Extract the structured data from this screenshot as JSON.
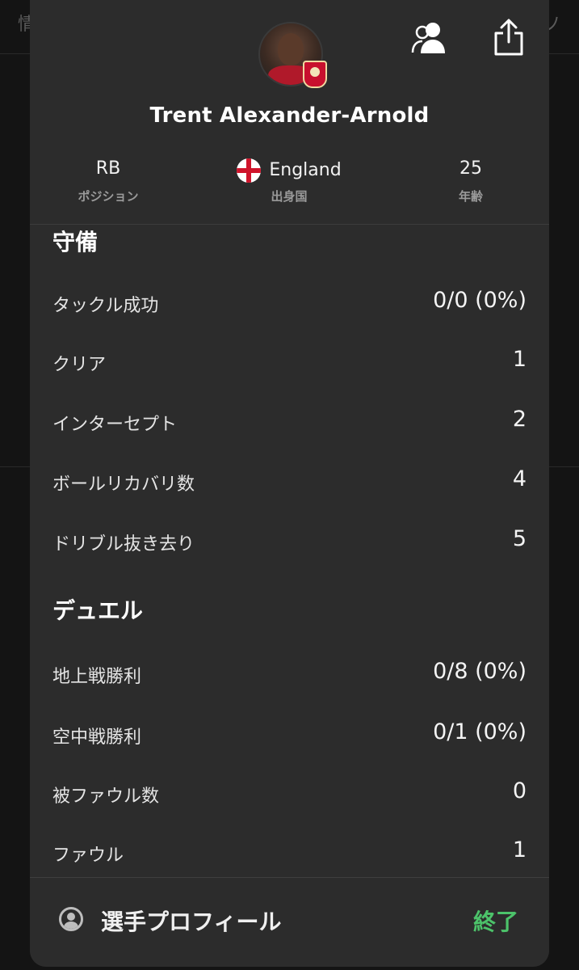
{
  "background": {
    "left_text": "情",
    "right_text": "ソ"
  },
  "header": {
    "icons": {
      "avatar": "player-photo",
      "badge": "club-badge",
      "compare": "people-icon",
      "share": "share-icon"
    },
    "player_name": "Trent Alexander-Arnold",
    "position": {
      "value": "RB",
      "label": "ポジション"
    },
    "country": {
      "value": "England",
      "label": "出身国",
      "flag": "england-flag"
    },
    "age": {
      "value": "25",
      "label": "年齢"
    }
  },
  "defense": {
    "title": "守備",
    "rows": [
      {
        "label": "タックル成功",
        "value": "0/0 (0%)"
      },
      {
        "label": "クリア",
        "value": "1"
      },
      {
        "label": "インターセプト",
        "value": "2"
      },
      {
        "label": "ボールリカバリ数",
        "value": "4"
      },
      {
        "label": "ドリブル抜き去り",
        "value": "5"
      }
    ]
  },
  "duel": {
    "title": "デュエル",
    "rows": [
      {
        "label": "地上戦勝利",
        "value": "0/8 (0%)"
      },
      {
        "label": "空中戦勝利",
        "value": "0/1 (0%)"
      },
      {
        "label": "被ファウル数",
        "value": "0"
      },
      {
        "label": "ファウル",
        "value": "1"
      }
    ]
  },
  "footer": {
    "profile_label": "選手プロフィール",
    "done_label": "終了",
    "done_color": "#4cc36a"
  }
}
